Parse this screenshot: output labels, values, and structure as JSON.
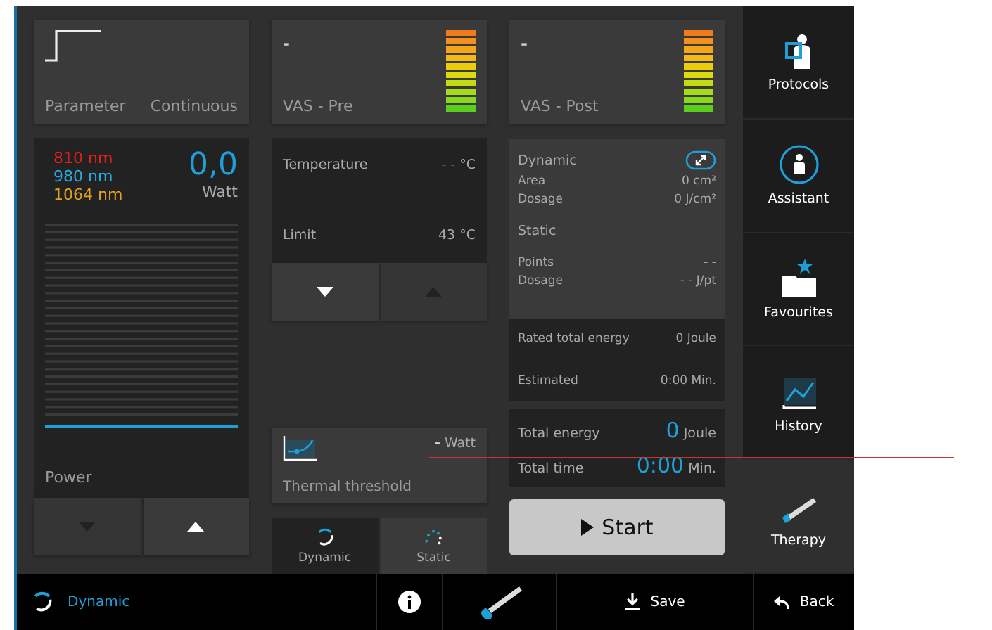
{
  "parameter_card": {
    "label": "Parameter",
    "mode": "Continuous"
  },
  "vas_cards": [
    {
      "value": "-",
      "label": "VAS - Pre"
    },
    {
      "value": "-",
      "label": "VAS - Post"
    }
  ],
  "power_panel": {
    "wavelengths": [
      {
        "label": "810 nm",
        "color": "#e0201c"
      },
      {
        "label": "980 nm",
        "color": "#2aa8e0"
      },
      {
        "label": "1064 nm",
        "color": "#e0a020"
      }
    ],
    "value": "0,0",
    "unit": "Watt",
    "label": "Power",
    "buttons": [
      {
        "kind": "down",
        "disabled": true
      },
      {
        "kind": "up",
        "disabled": false
      }
    ]
  },
  "temperature_panel": {
    "rows": [
      {
        "label": "Temperature",
        "value": "- -",
        "unit": "°C",
        "highlight": true
      },
      {
        "label": "Limit",
        "value": "43",
        "unit": "°C",
        "highlight": false
      }
    ],
    "buttons": [
      {
        "kind": "down",
        "disabled": false
      },
      {
        "kind": "up",
        "disabled": true
      }
    ]
  },
  "thermal_threshold": {
    "value": "-",
    "unit": "Watt",
    "label": "Thermal threshold"
  },
  "mode_toggle": [
    {
      "label": "Dynamic",
      "kind": "dynamic",
      "selected": true
    },
    {
      "label": "Static",
      "kind": "static",
      "selected": false
    }
  ],
  "dynamic_panel": {
    "title": "Dynamic",
    "rows": [
      {
        "label": "Area",
        "value": "0 cm²"
      },
      {
        "label": "Dosage",
        "value": "0 J/cm²"
      }
    ]
  },
  "static_section": {
    "title": "Static",
    "rows": [
      {
        "label": "Points",
        "value": "- -"
      },
      {
        "label": "Dosage",
        "value": "- - J/pt"
      }
    ]
  },
  "energy_panel": {
    "rows": [
      {
        "label": "Rated total energy",
        "value": "0 Joule"
      },
      {
        "label": "Estimated",
        "value": "0:00 Min."
      }
    ]
  },
  "totals_panel": {
    "rows": [
      {
        "label": "Total energy",
        "value": "0",
        "unit": "Joule"
      },
      {
        "label": "Total time",
        "value": "0:00",
        "unit": "Min."
      }
    ]
  },
  "start_button": {
    "label": "Start"
  },
  "sidebar": {
    "items": [
      {
        "label": "Protocols",
        "kind": "protocols",
        "selected": false
      },
      {
        "label": "Assistant",
        "kind": "assistant",
        "selected": false
      },
      {
        "label": "Favourites",
        "kind": "favourites",
        "selected": false
      },
      {
        "label": "History",
        "kind": "history",
        "selected": false
      },
      {
        "label": "Therapy",
        "kind": "therapy",
        "selected": true
      }
    ]
  },
  "bottom_bar": {
    "mode": "Dynamic",
    "save": "Save",
    "back": "Back"
  }
}
